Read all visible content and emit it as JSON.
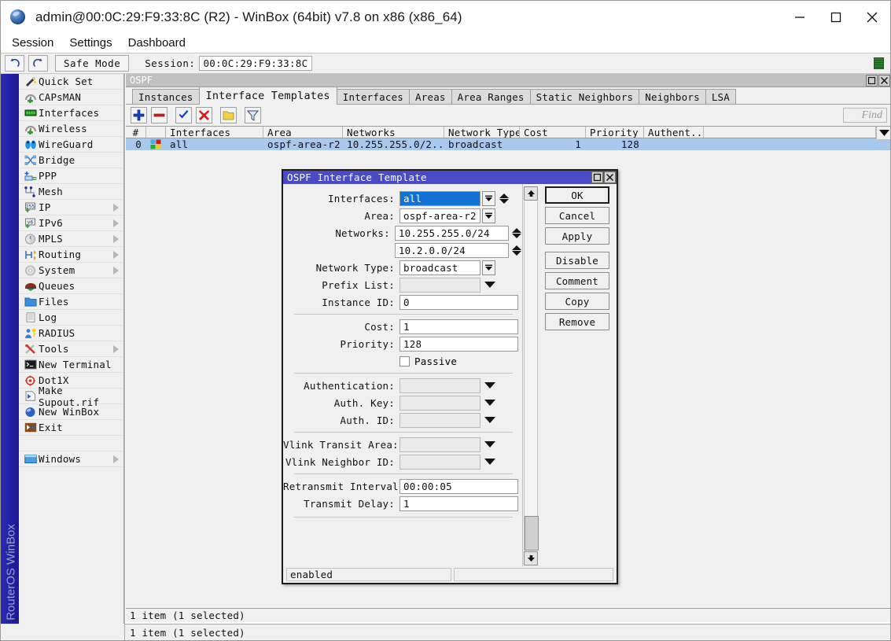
{
  "window": {
    "title": "admin@00:0C:29:F9:33:8C (R2) - WinBox (64bit) v7.8 on x86 (x86_64)",
    "icon": "winbox-globe-icon",
    "minimize": "minimize-button",
    "maximize": "maximize-button",
    "close": "close-button"
  },
  "menubar": {
    "items": [
      "Session",
      "Settings",
      "Dashboard"
    ]
  },
  "toolbar": {
    "undo": "undo-icon",
    "redo": "redo-icon",
    "safe_mode": "Safe Mode",
    "session_label": "Session:",
    "session_value": "00:0C:29:F9:33:8C"
  },
  "brand": {
    "text": "RouterOS WinBox"
  },
  "sidebar": {
    "items": [
      {
        "label": "Quick Set",
        "icon": "wand-icon",
        "arrow": false
      },
      {
        "label": "CAPsMAN",
        "icon": "antenna-icon",
        "arrow": false
      },
      {
        "label": "Interfaces",
        "icon": "interfaces-icon",
        "arrow": false
      },
      {
        "label": "Wireless",
        "icon": "antenna-icon",
        "arrow": false
      },
      {
        "label": "WireGuard",
        "icon": "wireguard-icon",
        "arrow": false
      },
      {
        "label": "Bridge",
        "icon": "bridge-icon",
        "arrow": false
      },
      {
        "label": "PPP",
        "icon": "ppp-icon",
        "arrow": false
      },
      {
        "label": "Mesh",
        "icon": "mesh-icon",
        "arrow": false
      },
      {
        "label": "IP",
        "icon": "ip-icon",
        "arrow": true
      },
      {
        "label": "IPv6",
        "icon": "ipv6-icon",
        "arrow": true
      },
      {
        "label": "MPLS",
        "icon": "mpls-icon",
        "arrow": true
      },
      {
        "label": "Routing",
        "icon": "routing-icon",
        "arrow": true
      },
      {
        "label": "System",
        "icon": "gear-icon",
        "arrow": true
      },
      {
        "label": "Queues",
        "icon": "queues-icon",
        "arrow": false
      },
      {
        "label": "Files",
        "icon": "folder-icon",
        "arrow": false
      },
      {
        "label": "Log",
        "icon": "log-icon",
        "arrow": false
      },
      {
        "label": "RADIUS",
        "icon": "radius-icon",
        "arrow": false
      },
      {
        "label": "Tools",
        "icon": "tools-icon",
        "arrow": true
      },
      {
        "label": "New Terminal",
        "icon": "terminal-icon",
        "arrow": false
      },
      {
        "label": "Dot1X",
        "icon": "dot1x-icon",
        "arrow": false
      },
      {
        "label": "Make Supout.rif",
        "icon": "supout-icon",
        "arrow": false
      },
      {
        "label": "New WinBox",
        "icon": "winbox-globe-icon",
        "arrow": false
      },
      {
        "label": "Exit",
        "icon": "exit-icon",
        "arrow": false
      }
    ],
    "windows_item": {
      "label": "Windows",
      "icon": "window-icon",
      "arrow": true
    }
  },
  "ospf_window": {
    "title": "OSPF",
    "restore": "restore-button",
    "close": "close-button",
    "tabs": [
      {
        "label": "Instances",
        "active": false
      },
      {
        "label": "Interface Templates",
        "active": true
      },
      {
        "label": "Interfaces",
        "active": false
      },
      {
        "label": "Areas",
        "active": false
      },
      {
        "label": "Area Ranges",
        "active": false
      },
      {
        "label": "Static Neighbors",
        "active": false
      },
      {
        "label": "Neighbors",
        "active": false
      },
      {
        "label": "LSA",
        "active": false
      }
    ],
    "toolbar_buttons": [
      {
        "name": "add-button",
        "icon": "plus-icon"
      },
      {
        "name": "remove-button",
        "icon": "minus-icon"
      },
      {
        "name": "enable-button",
        "icon": "check-icon"
      },
      {
        "name": "disable-button",
        "icon": "cross-icon"
      },
      {
        "name": "comment-button",
        "icon": "note-icon"
      },
      {
        "name": "filter-button",
        "icon": "funnel-icon"
      }
    ],
    "find_placeholder": "Find",
    "table": {
      "columns": [
        "#",
        "",
        "Interfaces",
        "Area",
        "Networks",
        "Network Type",
        "Cost",
        "Priority",
        "Authent..."
      ],
      "rows": [
        {
          "num": "0",
          "flag_icon": "template-flag-icon",
          "interfaces": "all",
          "area": "ospf-area-r2",
          "networks": "10.255.255.0/2...",
          "network_type": "broadcast",
          "cost": "1",
          "priority": "128",
          "authentication": ""
        }
      ]
    },
    "status": "1 item (1 selected)"
  },
  "dialog": {
    "title": "OSPF Interface Template",
    "restore": "restore-button",
    "close": "close-button",
    "fields": {
      "interfaces": {
        "label": "Interfaces:",
        "value": "all"
      },
      "area": {
        "label": "Area:",
        "value": "ospf-area-r2"
      },
      "networks": {
        "label": "Networks:",
        "value1": "10.255.255.0/24",
        "value2": "10.2.0.0/24"
      },
      "network_type": {
        "label": "Network Type:",
        "value": "broadcast"
      },
      "prefix_list": {
        "label": "Prefix List:",
        "value": ""
      },
      "instance_id": {
        "label": "Instance ID:",
        "value": "0"
      },
      "cost": {
        "label": "Cost:",
        "value": "1"
      },
      "priority": {
        "label": "Priority:",
        "value": "128"
      },
      "passive": {
        "label": "Passive",
        "checked": false
      },
      "authentication": {
        "label": "Authentication:",
        "value": ""
      },
      "auth_key": {
        "label": "Auth. Key:",
        "value": ""
      },
      "auth_id": {
        "label": "Auth. ID:",
        "value": ""
      },
      "vlink_transit_area": {
        "label": "Vlink Transit Area:",
        "value": ""
      },
      "vlink_neighbor_id": {
        "label": "Vlink Neighbor ID:",
        "value": ""
      },
      "retransmit_interval": {
        "label": "Retransmit Interval:",
        "value": "00:00:05"
      },
      "transmit_delay": {
        "label": "Transmit Delay:",
        "value": "1"
      }
    },
    "buttons": [
      "OK",
      "Cancel",
      "Apply",
      "Disable",
      "Comment",
      "Copy",
      "Remove"
    ],
    "status": "enabled",
    "status2": ""
  },
  "colors": {
    "accent_blue": "#1072d4",
    "dialog_title": "#4b4bc8",
    "sidebar_strip": "#2222a6",
    "row_selected": "#a8c8ec"
  }
}
